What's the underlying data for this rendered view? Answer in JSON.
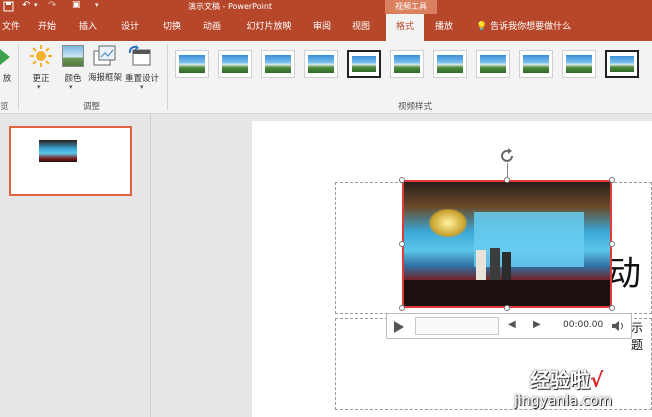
{
  "titlebar": {
    "document_title": "演示文稿 - PowerPoint",
    "context_header": "视频工具",
    "quick_access": [
      "save-icon",
      "undo-icon",
      "redo-icon",
      "start-from-beginning-icon",
      "customize-icon"
    ]
  },
  "tabs": [
    {
      "label": "文件"
    },
    {
      "label": "开始"
    },
    {
      "label": "插入"
    },
    {
      "label": "设计"
    },
    {
      "label": "切换"
    },
    {
      "label": "动画"
    },
    {
      "label": "幻灯片放映"
    },
    {
      "label": "审阅"
    },
    {
      "label": "视图"
    },
    {
      "label": "格式",
      "active": true
    },
    {
      "label": "播放"
    }
  ],
  "tell_me": "告诉我你想要做什么",
  "ribbon": {
    "buttons": {
      "play": "放",
      "correct": "更正",
      "color": "颜色",
      "poster_frame": "海报框架",
      "reset_design": "重置设计"
    },
    "groups": {
      "preview": "览",
      "adjust": "调整",
      "video_styles": "视频样式"
    },
    "video_style_count": 11
  },
  "slide": {
    "title_fragment": "动",
    "subtitle_fragment": "示题"
  },
  "player": {
    "time": "00:00.00"
  },
  "watermark": {
    "line1": "经验啦",
    "check": "√",
    "line2": "jingyanla.com"
  },
  "colors": {
    "accent": "#b7472a",
    "selection": "#e03b3b",
    "thumbnail_border": "#e2643f"
  }
}
